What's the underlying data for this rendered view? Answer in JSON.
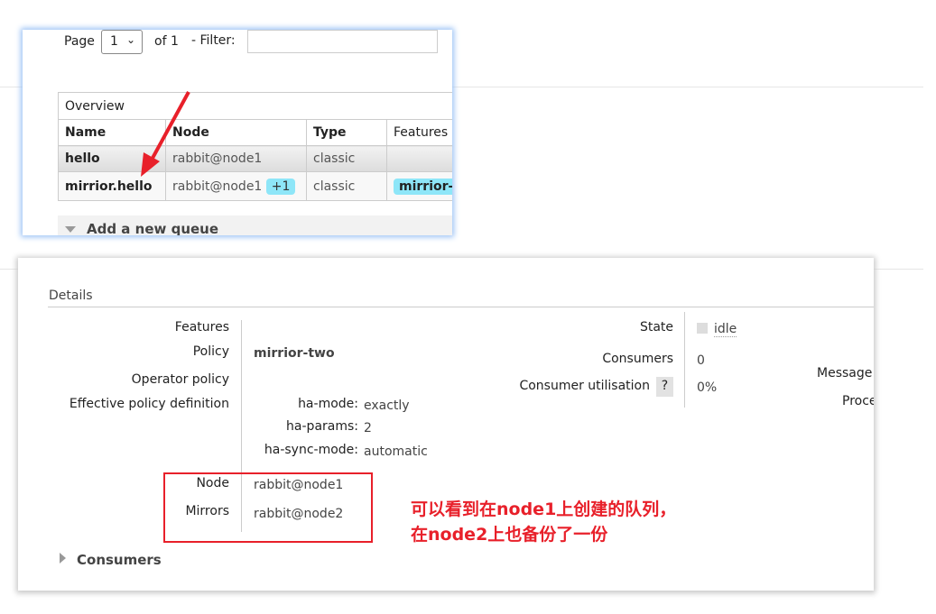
{
  "queues_panel": {
    "page_label": "Page",
    "page_value": "1",
    "of_label": "of 1",
    "filter_label": "- Filter:",
    "filter_value": "",
    "table_caption": "Overview",
    "columns": [
      "Name",
      "Node",
      "Type",
      "Features"
    ],
    "rows": [
      {
        "name": "hello",
        "node": "rabbit@node1",
        "extra": "",
        "type": "classic",
        "feature": ""
      },
      {
        "name": "mirrior.hello",
        "node": "rabbit@node1",
        "extra": "+1",
        "type": "classic",
        "feature": "mirrior-"
      }
    ],
    "add_queue": "Add a new queue"
  },
  "details": {
    "section_title": "Details",
    "features_label": "Features",
    "policy_label": "Policy",
    "policy_value": "mirrior-two",
    "operator_policy_label": "Operator policy",
    "effective_label": "Effective policy definition",
    "effective": [
      {
        "k": "ha-mode:",
        "v": "exactly"
      },
      {
        "k": "ha-params:",
        "v": "2"
      },
      {
        "k": "ha-sync-mode:",
        "v": "automatic"
      }
    ],
    "node_label": "Node",
    "node_value": "rabbit@node1",
    "mirrors_label": "Mirrors",
    "mirrors_value": "rabbit@node2",
    "state_label": "State",
    "state_value": "idle",
    "consumers_label": "Consumers",
    "consumers_value": "0",
    "util_label": "Consumer utilisation",
    "util_help": "?",
    "util_value": "0%",
    "messages_label": "Message",
    "process_label": "Proce",
    "consumers_section": "Consumers"
  },
  "annotation": {
    "line1": "可以看到在node1上创建的队列，",
    "line2": "在node2上也备份了一份",
    "color": "#e8202a"
  }
}
